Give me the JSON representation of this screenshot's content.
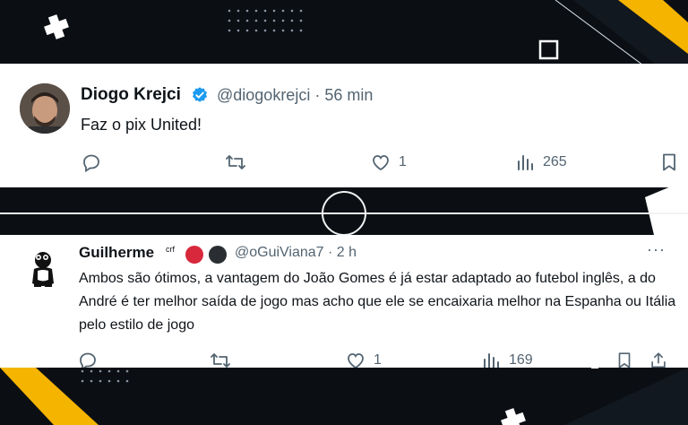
{
  "colors": {
    "background": "#0b0f14",
    "accent_yellow": "#f5b400",
    "verified_blue": "#1d9bf0",
    "text_primary": "#0f1419",
    "text_secondary": "#536471",
    "badge_red": "#d8283c"
  },
  "tweet1": {
    "author": "Diogo Krejci",
    "handle_time": "@diogokrejci · 56 min",
    "text": "Faz o pix United!",
    "likes": "1",
    "views": "265",
    "icons": [
      "avatar",
      "verified-badge",
      "reply-icon",
      "retweet-icon",
      "like-icon",
      "views-icon",
      "bookmark-icon"
    ]
  },
  "tweet2": {
    "author": "Guilherme",
    "author_sup": "crf",
    "handle_time": "@oGuiViana7 · 2 h",
    "more": "···",
    "text": "Ambos são ótimos, a vantagem do João Gomes é já estar adaptado ao futebol inglês, a do André é ter melhor saída de jogo mas acho que ele se encaixaria melhor na Espanha ou Itália pelo estilo de jogo",
    "likes": "1",
    "views": "169",
    "icons": [
      "avatar",
      "flag-badge-red",
      "flag-badge-dark",
      "more-icon",
      "reply-icon",
      "retweet-icon",
      "like-icon",
      "views-icon",
      "bookmark-icon",
      "share-icon"
    ]
  }
}
